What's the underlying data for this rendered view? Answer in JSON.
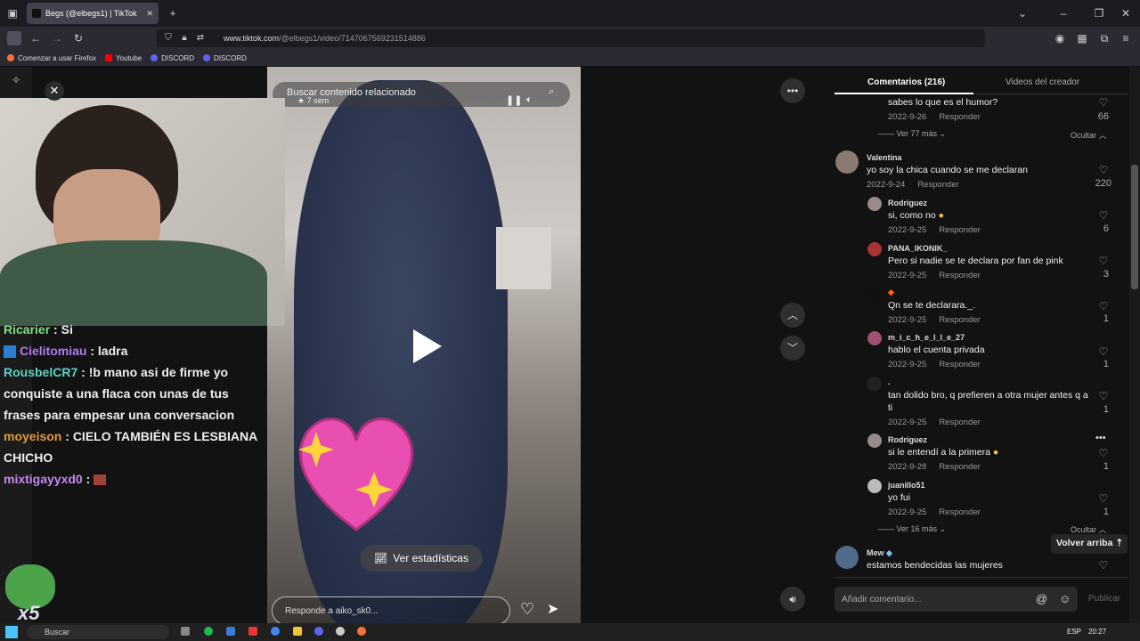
{
  "browser": {
    "tab_title": "Begs (@elbegs1) | TikTok",
    "url_prefix": "www.tiktok.com",
    "url_path": "/@elbegs1/video/7147067569231514886",
    "bookmarks": [
      "Comenzar a usar Firefox",
      "Youtube",
      "DISCORD",
      "DISCORD"
    ]
  },
  "video": {
    "search_placeholder": "Buscar contenido relacionado",
    "age": "7 sem",
    "stats_label": "Ver estadísticas",
    "reply_placeholder": "Responde a aiko_sk0..."
  },
  "chat": [
    {
      "user": "Ricarier",
      "sep": " : ",
      "msg": "Si",
      "color": "#7ee07e"
    },
    {
      "user": "Cielitomiau",
      "sep": " : ",
      "msg": "ladra",
      "color": "#b07cf0"
    },
    {
      "user": "RousbelCR7",
      "sep": " : ",
      "msg": "!b mano asi de firme yo conquiste a una flaca con unas de tus frases para empesar una conversacion",
      "color": "#5fd3c4"
    },
    {
      "user": "moyeison",
      "sep": " : ",
      "msg": "CIELO TAMBIÉN ES LESBIANA CHICHO",
      "color": "#e09a3a"
    },
    {
      "user": "mixtigayyxd0",
      "sep": " : ",
      "msg": "",
      "color": "#c58af0"
    }
  ],
  "overlay": {
    "badge": "x5"
  },
  "panel": {
    "tab_comments": "Comentarios (216)",
    "tab_videos": "Videos del creador",
    "back_top": "Volver arriba",
    "add_comment": "Añadir comentario...",
    "publish": "Publicar",
    "reply_label": "Responder"
  },
  "comments": [
    {
      "name": "",
      "text": "sabes lo que es el humor?",
      "date": "2022-9-26",
      "likes": "66",
      "more": "Ver 77 más",
      "hide": "Ocultar"
    },
    {
      "name": "Valentina",
      "text": "yo soy la chica cuando se me declaran",
      "date": "2022-9-24",
      "likes": "220"
    },
    {
      "name": "Rodríguez",
      "text": "si, como no",
      "date": "2022-9-25",
      "likes": "6"
    },
    {
      "name": "PANA_IKONIK_",
      "text": "Pero si nadie se te declara por fan de pink",
      "date": "2022-9-25",
      "likes": "3"
    },
    {
      "name": "",
      "text": "Qn se te declarara._.",
      "date": "2022-9-25",
      "likes": "1"
    },
    {
      "name": "m_i_c_h_e_l_l_e_27",
      "text": "hablo el cuenta privada",
      "date": "2022-9-25",
      "likes": "1"
    },
    {
      "name": ".",
      "text": "tan dolido bro, q prefieren a otra mujer antes q a ti",
      "date": "2022-9-25",
      "likes": "1"
    },
    {
      "name": "Rodríguez",
      "text": "si le entendí a la primera",
      "date": "2022-9-28",
      "likes": "1"
    },
    {
      "name": "juanillo51",
      "text": "yo fui",
      "date": "2022-9-25",
      "likes": "1",
      "more": "Ver 16 más",
      "hide": "Ocultar"
    },
    {
      "name": "Mew",
      "text": "estamos bendecidas las mujeres",
      "date": "",
      "likes": ""
    }
  ],
  "taskbar": {
    "search": "Buscar",
    "lang": "ESP",
    "time": "20:27"
  },
  "colors": {
    "accent": "#fe2c55",
    "panel_bg": "#121212"
  }
}
